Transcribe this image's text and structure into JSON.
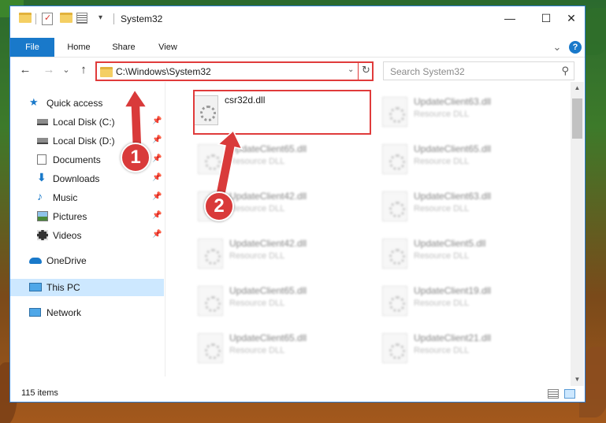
{
  "window": {
    "title": "System32",
    "controls": {
      "minimize": "—",
      "maximize": "☐",
      "close": "✕"
    }
  },
  "ribbon": {
    "tabs": [
      "File",
      "Home",
      "Share",
      "View"
    ],
    "collapse_glyph": "⌄",
    "help_glyph": "?"
  },
  "nav": {
    "back": "←",
    "forward": "→",
    "recent": "⌄",
    "up": "↑",
    "address": "C:\\Windows\\System32",
    "refresh": "↻",
    "dropdown": "⌄"
  },
  "search": {
    "placeholder": "Search System32"
  },
  "sidebar": {
    "items": [
      {
        "label": "Quick access",
        "icon": "star-icon"
      },
      {
        "label": "Local Disk (C:)",
        "icon": "drive-icon",
        "pinned": true
      },
      {
        "label": "Local Disk (D:)",
        "icon": "drive-icon",
        "pinned": true
      },
      {
        "label": "Documents",
        "icon": "documents-icon",
        "pinned": true
      },
      {
        "label": "Downloads",
        "icon": "downloads-icon",
        "pinned": true
      },
      {
        "label": "Music",
        "icon": "music-icon",
        "pinned": true
      },
      {
        "label": "Pictures",
        "icon": "pictures-icon",
        "pinned": true
      },
      {
        "label": "Videos",
        "icon": "videos-icon",
        "pinned": true
      },
      {
        "label": "OneDrive",
        "icon": "cloud-icon"
      },
      {
        "label": "This PC",
        "icon": "computer-icon",
        "selected": true
      },
      {
        "label": "Network",
        "icon": "network-icon"
      }
    ]
  },
  "files": [
    {
      "name": "csr32d.dll",
      "type": "",
      "highlight": true
    },
    {
      "name": "UpdateClient63.dll",
      "type": "Resource DLL"
    },
    {
      "name": "UpdateClient65.dll",
      "type": "Resource DLL"
    },
    {
      "name": "UpdateClient65.dll",
      "type": "Resource DLL"
    },
    {
      "name": "UpdateClient42.dll",
      "type": "Resource DLL"
    },
    {
      "name": "UpdateClient63.dll",
      "type": "Resource DLL"
    },
    {
      "name": "UpdateClient42.dll",
      "type": "Resource DLL"
    },
    {
      "name": "UpdateClient5.dll",
      "type": "Resource DLL"
    },
    {
      "name": "UpdateClient65.dll",
      "type": "Resource DLL"
    },
    {
      "name": "UpdateClient19.dll",
      "type": "Resource DLL"
    },
    {
      "name": "UpdateClient65.dll",
      "type": "Resource DLL"
    },
    {
      "name": "UpdateClient21.dll",
      "type": "Resource DLL"
    }
  ],
  "status": {
    "count": "115 items"
  },
  "annotations": {
    "step1": "1",
    "step2": "2"
  },
  "colors": {
    "accent": "#1979ca",
    "highlight": "#e03b3b",
    "selection": "#cde8ff"
  }
}
